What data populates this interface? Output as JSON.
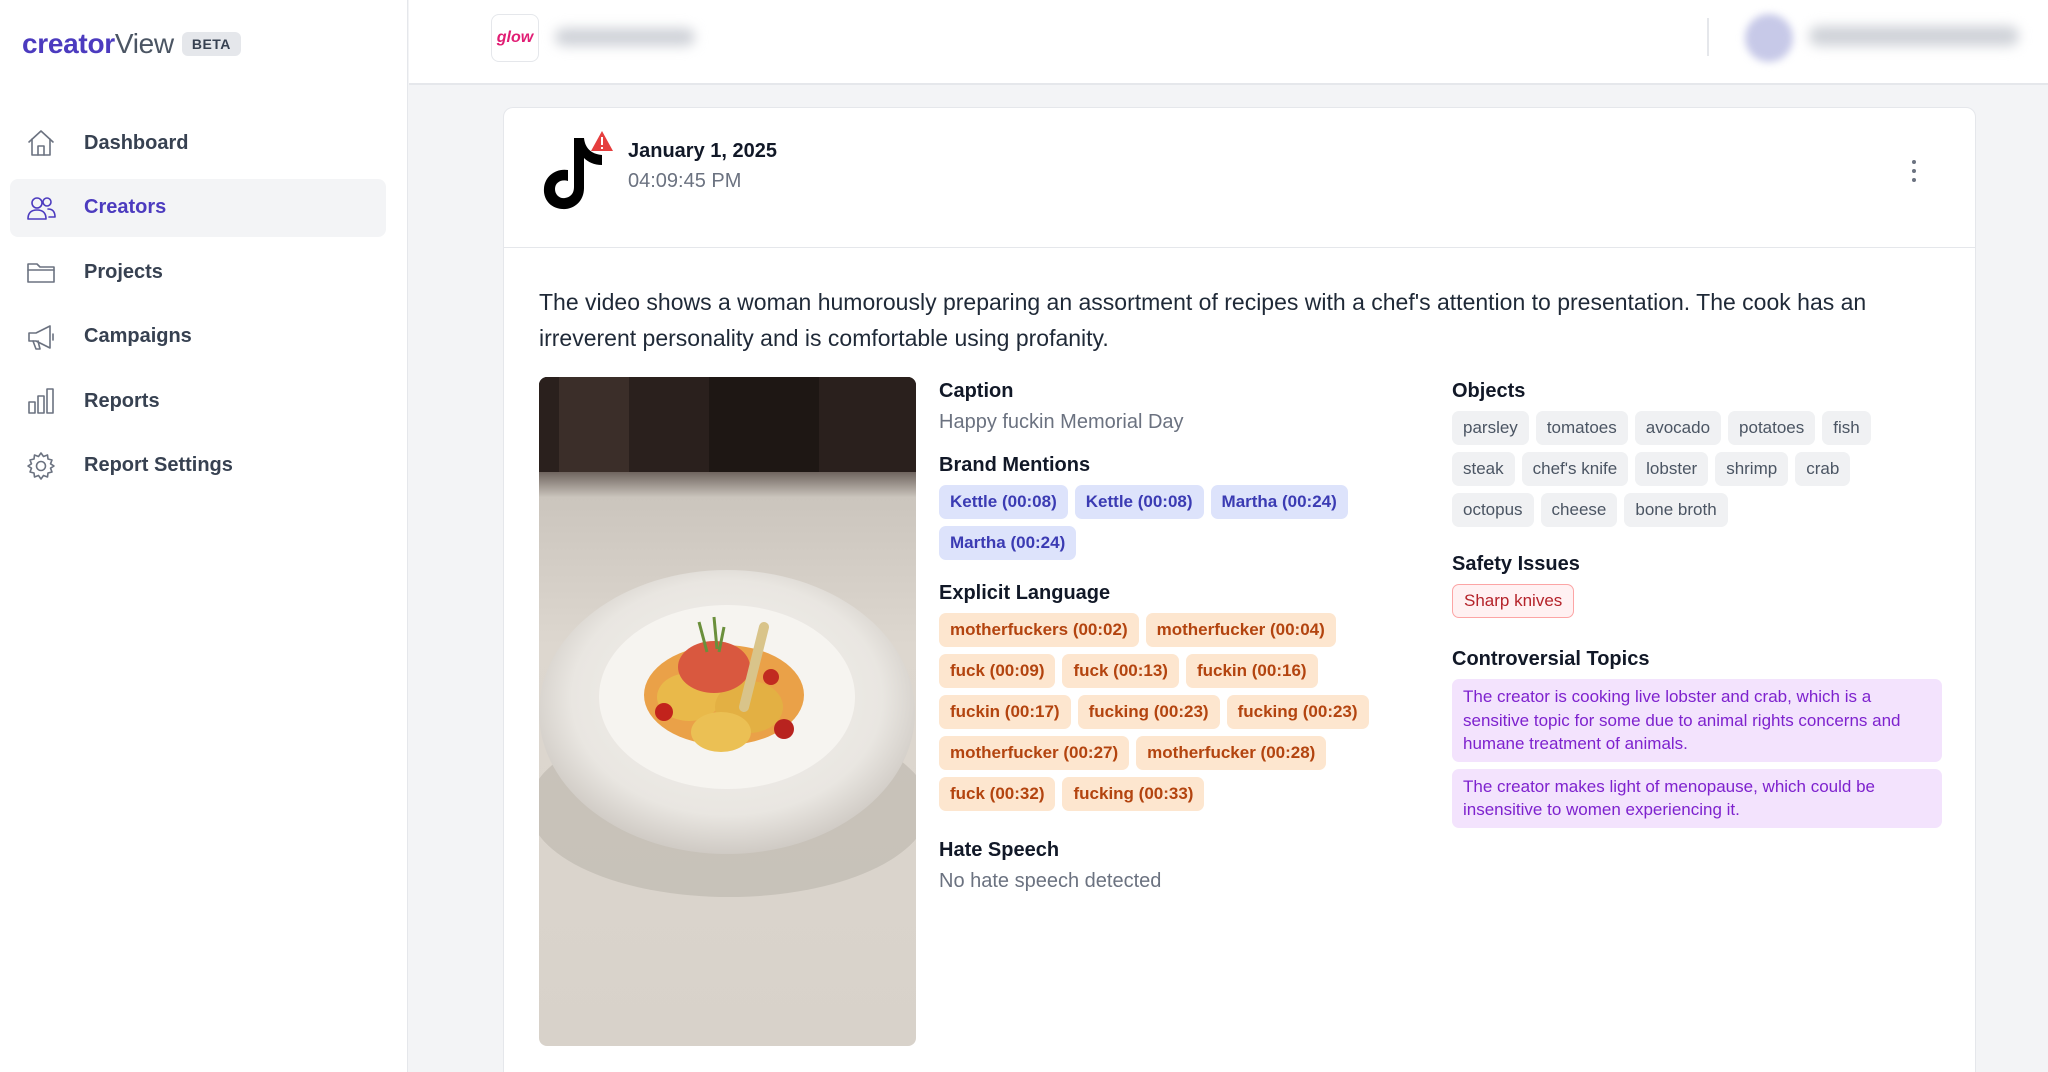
{
  "colors": {
    "accent": "#4c3bbf",
    "brand_tag_bg": "#dde3fb",
    "explicit_tag_bg": "#fde6cf",
    "topic_bg": "#f3e3fd",
    "safety_text": "#b4232a"
  },
  "sidebar": {
    "logo": {
      "part1": "creator",
      "part2": "View",
      "badge": "BETA"
    },
    "items": [
      {
        "label": "Dashboard",
        "icon": "home-icon",
        "active": false
      },
      {
        "label": "Creators",
        "icon": "users-icon",
        "active": true
      },
      {
        "label": "Projects",
        "icon": "folder-icon",
        "active": false
      },
      {
        "label": "Campaigns",
        "icon": "megaphone-icon",
        "active": false
      },
      {
        "label": "Reports",
        "icon": "bar-chart-icon",
        "active": false
      },
      {
        "label": "Report Settings",
        "icon": "gear-icon",
        "active": false
      }
    ]
  },
  "topbar": {
    "brand_logo_text": "glow"
  },
  "post": {
    "platform_icon": "tiktok-icon",
    "alert_icon": "warning-icon",
    "date": "January 1, 2025",
    "time": "04:09:45 PM",
    "summary": "The video shows a woman humorously preparing an assortment of recipes with a chef's attention to presentation. The cook has an irreverent personality and is comfortable using profanity.",
    "caption_title": "Caption",
    "caption": "Happy fuckin Memorial Day",
    "brand_mentions_title": "Brand Mentions",
    "brand_mentions": [
      "Kettle (00:08)",
      "Kettle (00:08)",
      "Martha (00:24)",
      "Martha (00:24)"
    ],
    "explicit_title": "Explicit Language",
    "explicit": [
      "motherfuckers (00:02)",
      "motherfucker (00:04)",
      "fuck (00:09)",
      "fuck (00:13)",
      "fuckin (00:16)",
      "fuckin (00:17)",
      "fucking (00:23)",
      "fucking (00:23)",
      "motherfucker (00:27)",
      "motherfucker (00:28)",
      "fuck (00:32)",
      "fucking (00:33)"
    ],
    "hate_title": "Hate Speech",
    "hate_text": "No hate speech detected",
    "objects_title": "Objects",
    "objects": [
      "parsley",
      "tomatoes",
      "avocado",
      "potatoes",
      "fish",
      "steak",
      "chef's knife",
      "lobster",
      "shrimp",
      "crab",
      "octopus",
      "cheese",
      "bone broth"
    ],
    "safety_title": "Safety Issues",
    "safety": [
      "Sharp knives"
    ],
    "controversial_title": "Controversial Topics",
    "controversial": [
      "The creator is cooking live lobster and crab, which is a sensitive topic for some due to animal rights concerns and humane treatment of animals.",
      "The creator makes light of menopause, which could be insensitive to women experiencing it."
    ]
  }
}
